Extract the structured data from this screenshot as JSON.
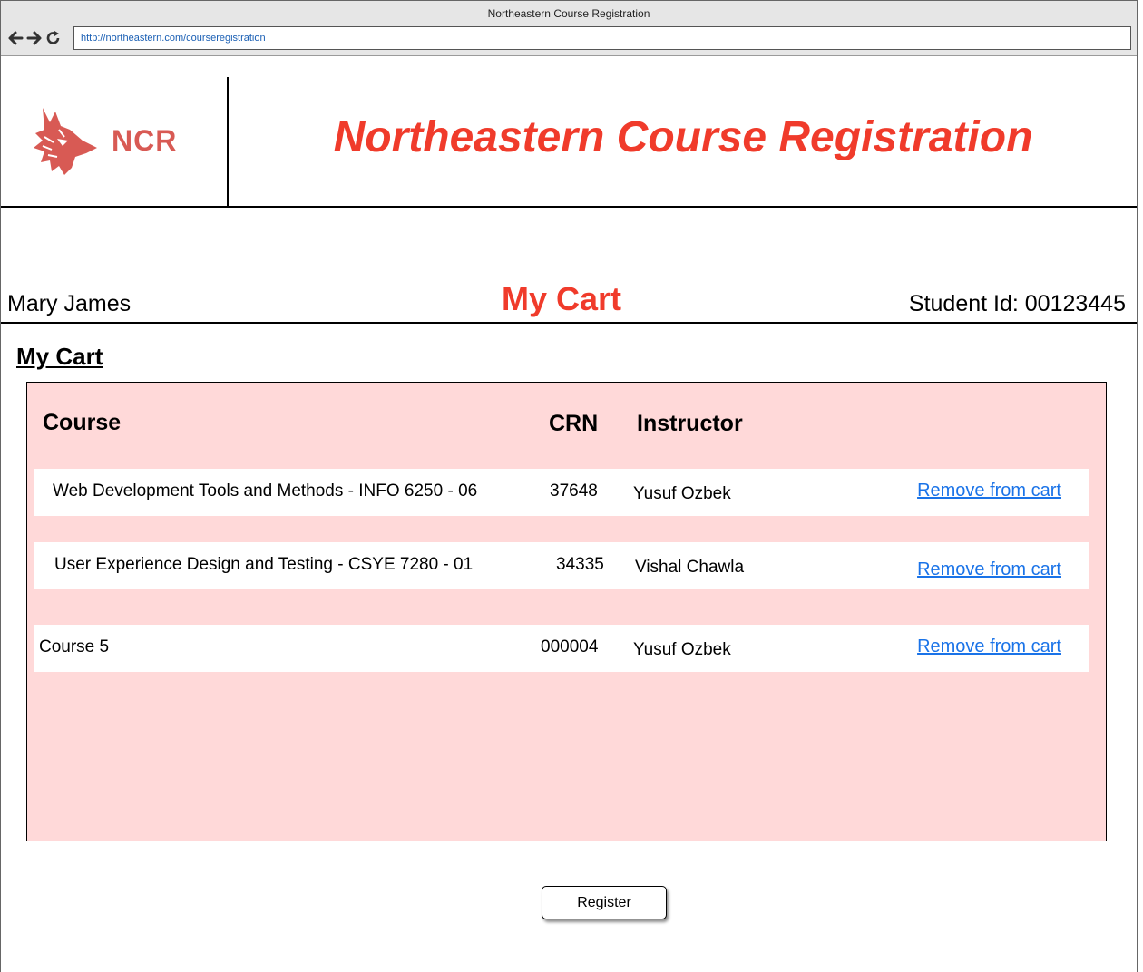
{
  "window": {
    "title": "Northeastern Course Registration",
    "url": "http://northeastern.com/courseregistration"
  },
  "header": {
    "logo_text": "NCR",
    "site_title": "Northeastern Course Registration"
  },
  "user": {
    "name": "Mary James",
    "page_heading": "My Cart",
    "student_id": "Student Id: 00123445"
  },
  "cart": {
    "section_title": "My Cart",
    "columns": {
      "course": "Course",
      "crn": "CRN",
      "instructor": "Instructor"
    },
    "rows": [
      {
        "course": "Web Development Tools and Methods - INFO 6250 - 06",
        "crn": "37648",
        "instructor": "Yusuf Ozbek",
        "action": "Remove from cart"
      },
      {
        "course": "User Experience Design and Testing - CSYE 7280 - 01",
        "crn": "34335",
        "instructor": "Vishal Chawla",
        "action": "Remove from cart"
      },
      {
        "course": "Course 5",
        "crn": "000004",
        "instructor": "Yusuf Ozbek",
        "action": "Remove from cart"
      }
    ]
  },
  "actions": {
    "register": "Register"
  },
  "colors": {
    "accent": "#f03b2b",
    "logo": "#d85a54",
    "panel_bg": "#ffd9d9",
    "link": "#1a73e8"
  }
}
